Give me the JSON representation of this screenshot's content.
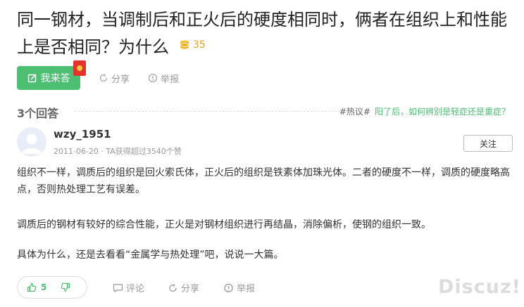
{
  "question": {
    "title": "同一钢材，当调制后和正火后的硬度相同时，俩者在组织上和性能上是否相同？为什么",
    "reward": "35",
    "reward_icon": "coin-stack-icon",
    "accent": "#4cbf73"
  },
  "actions": {
    "answer_label": "我来答",
    "share_label": "分享",
    "report_label": "举报"
  },
  "answers": {
    "count_label": "3个回答",
    "hot_tag": "#热议#",
    "hot_link": "阳了后，如何辨别是轻症还是重症？"
  },
  "answer": {
    "username": "wzy_1951",
    "meta": "2011-06-20 · TA获得超过3540个赞",
    "follow_label": "关注",
    "paragraphs": [
      "组织不一样，调质后的组织是回火索氏体，正火后的组织是铁素体加珠光体。二者的硬度不一样，调质的硬度略高点，否则热处理工艺有误差。",
      "调质后的钢材有较好的综合性能，正火是对钢材组织进行再结晶，消除偏析，使钢的组织一致。",
      "具体为什么，还是去看看“金属学与热处理”吧，说说一大篇。"
    ],
    "likes": "5",
    "comment_label": "评论",
    "share_label": "分享",
    "report_label": "举报"
  },
  "watermark": "Discuz!"
}
